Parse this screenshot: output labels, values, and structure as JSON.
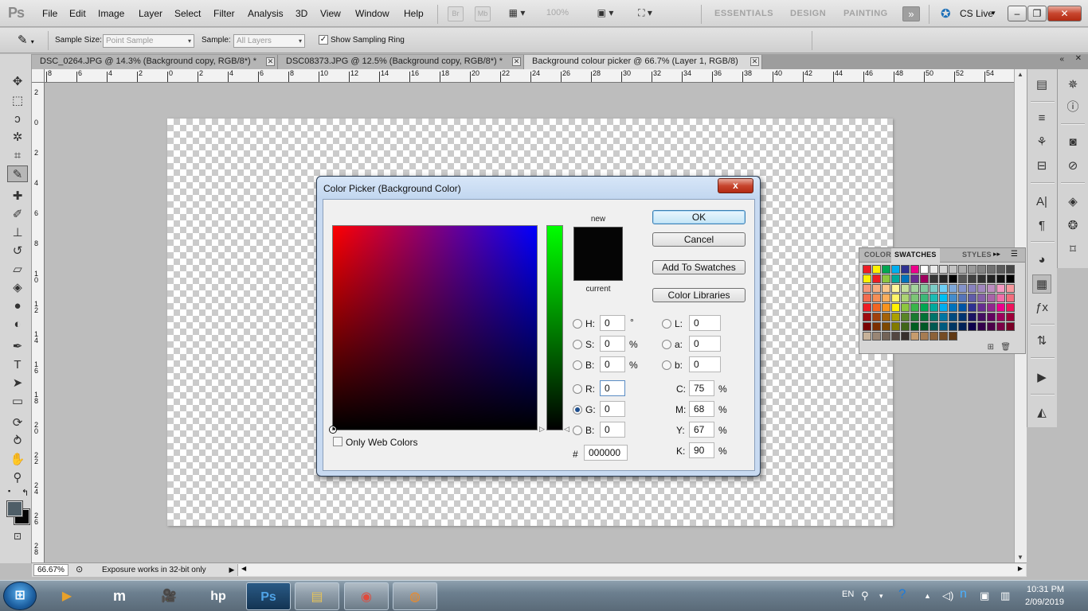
{
  "app": {
    "logo": "Ps"
  },
  "menu": [
    "File",
    "Edit",
    "Image",
    "Layer",
    "Select",
    "Filter",
    "Analysis",
    "3D",
    "View",
    "Window",
    "Help"
  ],
  "appbar": {
    "bridge": "Br",
    "minibridge": "Mb",
    "zoom": "100%"
  },
  "workspaces": [
    "ESSENTIALS",
    "DESIGN",
    "PAINTING"
  ],
  "cslive": "CS Live",
  "options": {
    "sample_size_label": "Sample Size:",
    "sample_size_value": "Point Sample",
    "sample_label": "Sample:",
    "sample_value": "All Layers",
    "ring_label": "Show Sampling Ring",
    "ring_checked": true
  },
  "tabs": [
    {
      "label": "DSC_0264.JPG @ 14.3% (Background copy, RGB/8*) *",
      "active": false
    },
    {
      "label": "DSC08373.JPG @ 12.5% (Background copy, RGB/8*) *",
      "active": false
    },
    {
      "label": "Background colour picker @ 66.7% (Layer 1, RGB/8)",
      "active": true
    }
  ],
  "ruler_top": [
    "8",
    "6",
    "4",
    "2",
    "0",
    "2",
    "4",
    "6",
    "8",
    "10",
    "12",
    "14",
    "16",
    "18",
    "20",
    "22",
    "24",
    "26",
    "28",
    "30",
    "32",
    "34",
    "36",
    "38",
    "40",
    "42",
    "44",
    "46",
    "48",
    "50",
    "52",
    "54"
  ],
  "ruler_left": [
    "2",
    "0",
    "2",
    "4",
    "6",
    "8",
    "1 0",
    "1 2",
    "1 4",
    "1 6",
    "1 8",
    "2 0",
    "2 2",
    "2 4",
    "2 6",
    "2 8"
  ],
  "status": {
    "zoom": "66.67%",
    "info": "Exposure works in 32-bit only"
  },
  "swatches_panel": {
    "tabs": [
      "COLOR",
      "SWATCHES",
      "STYLES"
    ],
    "active_tab": "SWATCHES",
    "rows": [
      [
        "#ed1c24",
        "#fff200",
        "#00a651",
        "#00aeef",
        "#2e3192",
        "#ec008c",
        "#ffffff",
        "#ebebeb",
        "#d7d7d7",
        "#c2c2c2",
        "#adadad",
        "#999999",
        "#848484",
        "#707070",
        "#5b5b5b",
        "#464646"
      ],
      [
        "#fff200",
        "#ed1c24",
        "#8dc63f",
        "#00a99d",
        "#0072bc",
        "#662d91",
        "#9e005d",
        "#363636",
        "#252525",
        "#000000",
        "#555555",
        "#404040",
        "#303030",
        "#222222",
        "#111111",
        "#000000"
      ],
      [
        "#f7977a",
        "#f9ad81",
        "#fdc68a",
        "#fff79a",
        "#c4df9b",
        "#a3d39c",
        "#82ca9d",
        "#7bcdc8",
        "#6ecff6",
        "#7ea7d8",
        "#8493ca",
        "#8882be",
        "#a187be",
        "#bc8dbf",
        "#f49ac2",
        "#f6989d"
      ],
      [
        "#f26c4f",
        "#f68e56",
        "#fbaf5d",
        "#fff568",
        "#acd373",
        "#7cc576",
        "#3cb878",
        "#1cbbb4",
        "#00bff3",
        "#448ccb",
        "#5574b9",
        "#605ca8",
        "#8560a8",
        "#a864a8",
        "#f06eaa",
        "#f26d7d"
      ],
      [
        "#ed1c24",
        "#f26522",
        "#f7941d",
        "#fff200",
        "#8dc63f",
        "#39b54a",
        "#00a651",
        "#00a99d",
        "#00aeef",
        "#0072bc",
        "#0054a6",
        "#2e3192",
        "#662d91",
        "#92278f",
        "#ec008c",
        "#ed145b"
      ],
      [
        "#9e0b0f",
        "#a0410d",
        "#a36209",
        "#aba000",
        "#598527",
        "#1a7b30",
        "#007236",
        "#00746b",
        "#0076a3",
        "#004b80",
        "#003471",
        "#1b1464",
        "#440e62",
        "#630460",
        "#9e005d",
        "#9e0039"
      ],
      [
        "#790000",
        "#7b2e00",
        "#7d4900",
        "#827b00",
        "#406618",
        "#005e20",
        "#005826",
        "#005952",
        "#005b7f",
        "#003663",
        "#002157",
        "#0d004c",
        "#32004b",
        "#4b0049",
        "#7b0046",
        "#7a0026"
      ],
      [
        "#c7b299",
        "#998675",
        "#736357",
        "#534741",
        "#37302d",
        "#c69c6d",
        "#a67c52",
        "#8c6239",
        "#754c24",
        "#603913"
      ]
    ]
  },
  "color_picker": {
    "title": "Color Picker (Background Color)",
    "close": "x",
    "new_label": "new",
    "current_label": "current",
    "buttons": {
      "ok": "OK",
      "cancel": "Cancel",
      "add": "Add To Swatches",
      "libraries": "Color Libraries"
    },
    "hsb": [
      {
        "label": "H:",
        "value": "0",
        "unit": "°"
      },
      {
        "label": "S:",
        "value": "0",
        "unit": "%"
      },
      {
        "label": "B:",
        "value": "0",
        "unit": "%"
      }
    ],
    "rgb": [
      {
        "label": "R:",
        "value": "0"
      },
      {
        "label": "G:",
        "value": "0",
        "selected": true
      },
      {
        "label": "B:",
        "value": "0"
      }
    ],
    "lab": [
      {
        "label": "L:",
        "value": "0"
      },
      {
        "label": "a:",
        "value": "0"
      },
      {
        "label": "b:",
        "value": "0"
      }
    ],
    "cmyk": [
      {
        "label": "C:",
        "value": "75",
        "unit": "%"
      },
      {
        "label": "M:",
        "value": "68",
        "unit": "%"
      },
      {
        "label": "Y:",
        "value": "67",
        "unit": "%"
      },
      {
        "label": "K:",
        "value": "90",
        "unit": "%"
      }
    ],
    "hex_label": "#",
    "hex_value": "000000",
    "web_only_label": "Only Web Colors",
    "web_only_checked": false
  },
  "taskbar": {
    "lang": "EN",
    "time": "10:31 PM",
    "date": "2/09/2019"
  }
}
